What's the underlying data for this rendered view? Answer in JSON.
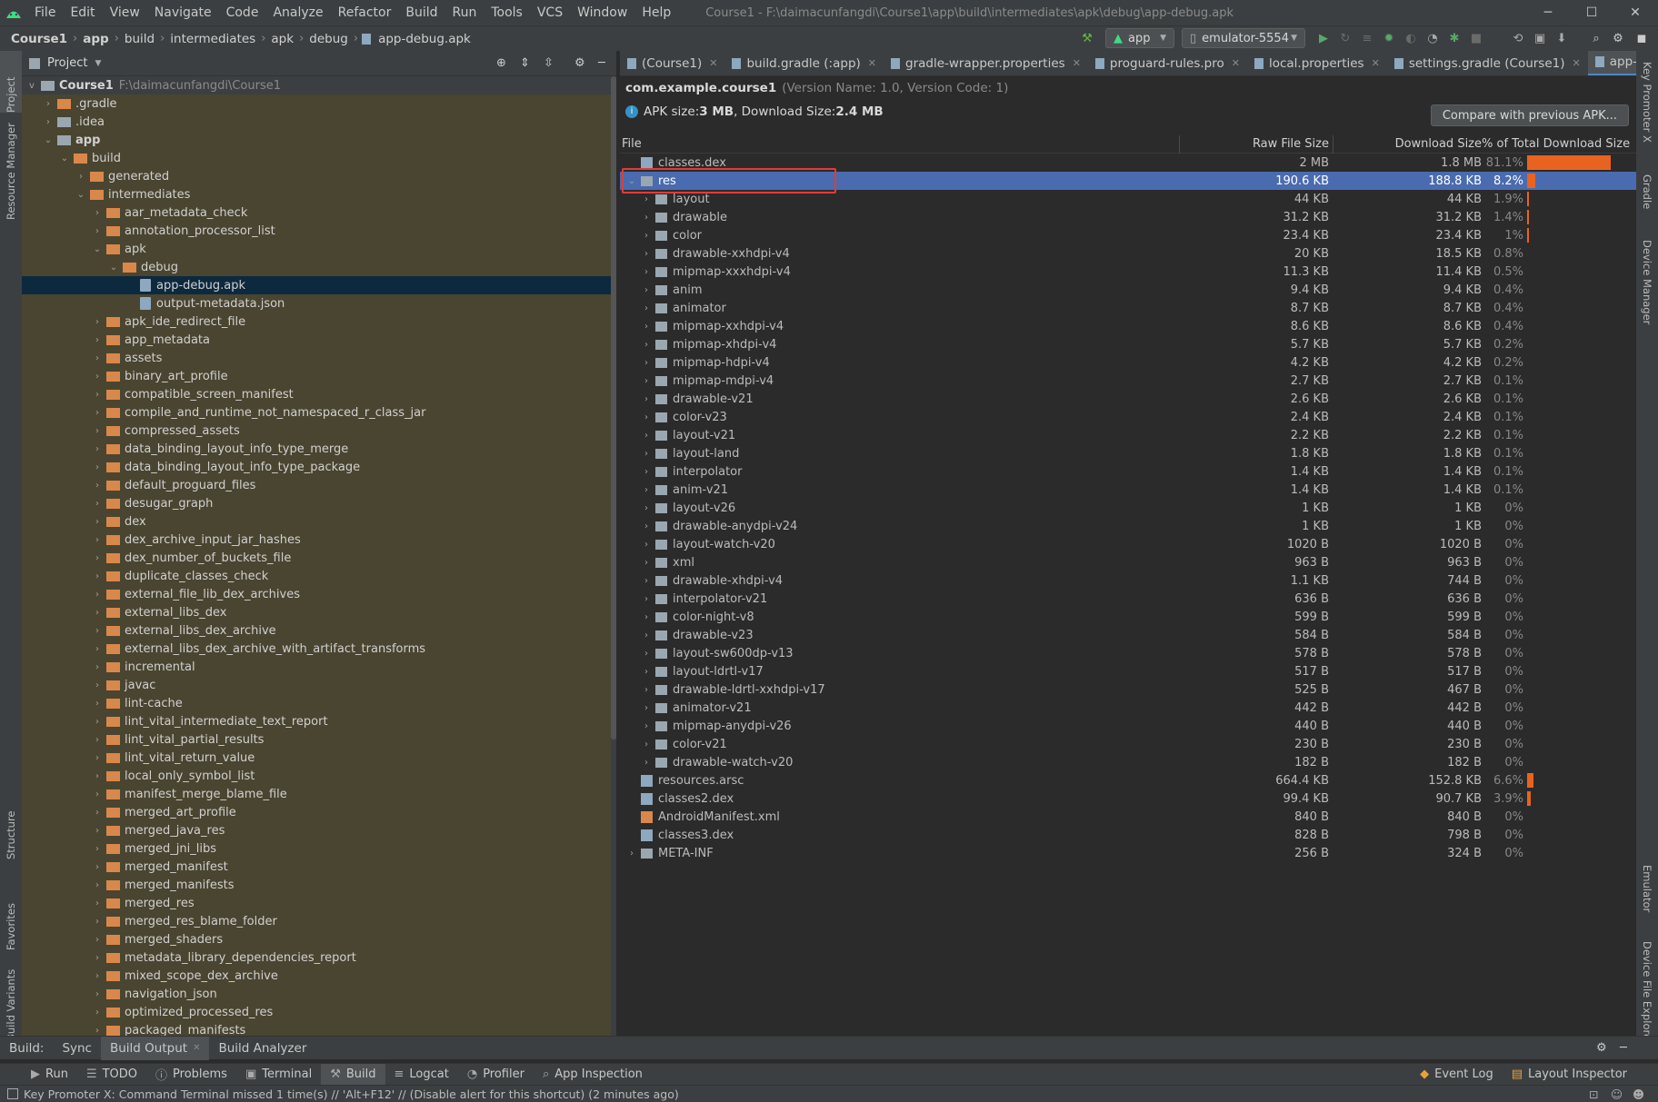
{
  "menubar": {
    "items": [
      "File",
      "Edit",
      "View",
      "Navigate",
      "Code",
      "Analyze",
      "Refactor",
      "Build",
      "Run",
      "Tools",
      "VCS",
      "Window",
      "Help"
    ],
    "window_title": "Course1 - F:\\daimacunfangdi\\Course1\\app\\build\\intermediates\\apk\\debug\\app-debug.apk"
  },
  "breadcrumb": [
    "Course1",
    "app",
    "build",
    "intermediates",
    "apk",
    "debug",
    "app-debug.apk"
  ],
  "toolbar": {
    "config": "app",
    "device": "emulator-5554"
  },
  "project_panel": {
    "title": "Project",
    "root_name": "Course1",
    "root_path": "F:\\daimacunfangdi\\Course1",
    "items": [
      {
        "label": ".gradle",
        "depth": 1,
        "arrow": ">",
        "kind": "orange",
        "hl": true
      },
      {
        "label": ".idea",
        "depth": 1,
        "arrow": ">",
        "kind": "grey",
        "hl": true
      },
      {
        "label": "app",
        "depth": 1,
        "arrow": "v",
        "kind": "grey",
        "hl": true,
        "bold": true
      },
      {
        "label": "build",
        "depth": 2,
        "arrow": "v",
        "kind": "orange",
        "hl": true
      },
      {
        "label": "generated",
        "depth": 3,
        "arrow": ">",
        "kind": "orange",
        "hl": true
      },
      {
        "label": "intermediates",
        "depth": 3,
        "arrow": "v",
        "kind": "orange",
        "hl": true
      },
      {
        "label": "aar_metadata_check",
        "depth": 4,
        "arrow": ">",
        "kind": "orange",
        "hl": true
      },
      {
        "label": "annotation_processor_list",
        "depth": 4,
        "arrow": ">",
        "kind": "orange",
        "hl": true
      },
      {
        "label": "apk",
        "depth": 4,
        "arrow": "v",
        "kind": "orange",
        "hl": true
      },
      {
        "label": "debug",
        "depth": 5,
        "arrow": "v",
        "kind": "orange",
        "hl": true
      },
      {
        "label": "app-debug.apk",
        "depth": 6,
        "arrow": "",
        "kind": "file",
        "sel": true
      },
      {
        "label": "output-metadata.json",
        "depth": 6,
        "arrow": "",
        "kind": "file",
        "hl": true
      },
      {
        "label": "apk_ide_redirect_file",
        "depth": 4,
        "arrow": ">",
        "kind": "orange",
        "hl": true
      },
      {
        "label": "app_metadata",
        "depth": 4,
        "arrow": ">",
        "kind": "orange",
        "hl": true
      },
      {
        "label": "assets",
        "depth": 4,
        "arrow": ">",
        "kind": "orange",
        "hl": true
      },
      {
        "label": "binary_art_profile",
        "depth": 4,
        "arrow": ">",
        "kind": "orange",
        "hl": true
      },
      {
        "label": "compatible_screen_manifest",
        "depth": 4,
        "arrow": ">",
        "kind": "orange",
        "hl": true
      },
      {
        "label": "compile_and_runtime_not_namespaced_r_class_jar",
        "depth": 4,
        "arrow": ">",
        "kind": "orange",
        "hl": true
      },
      {
        "label": "compressed_assets",
        "depth": 4,
        "arrow": ">",
        "kind": "orange",
        "hl": true
      },
      {
        "label": "data_binding_layout_info_type_merge",
        "depth": 4,
        "arrow": ">",
        "kind": "orange",
        "hl": true
      },
      {
        "label": "data_binding_layout_info_type_package",
        "depth": 4,
        "arrow": ">",
        "kind": "orange",
        "hl": true
      },
      {
        "label": "default_proguard_files",
        "depth": 4,
        "arrow": ">",
        "kind": "orange",
        "hl": true
      },
      {
        "label": "desugar_graph",
        "depth": 4,
        "arrow": ">",
        "kind": "orange",
        "hl": true
      },
      {
        "label": "dex",
        "depth": 4,
        "arrow": ">",
        "kind": "orange",
        "hl": true
      },
      {
        "label": "dex_archive_input_jar_hashes",
        "depth": 4,
        "arrow": ">",
        "kind": "orange",
        "hl": true
      },
      {
        "label": "dex_number_of_buckets_file",
        "depth": 4,
        "arrow": ">",
        "kind": "orange",
        "hl": true
      },
      {
        "label": "duplicate_classes_check",
        "depth": 4,
        "arrow": ">",
        "kind": "orange",
        "hl": true
      },
      {
        "label": "external_file_lib_dex_archives",
        "depth": 4,
        "arrow": ">",
        "kind": "orange",
        "hl": true
      },
      {
        "label": "external_libs_dex",
        "depth": 4,
        "arrow": ">",
        "kind": "orange",
        "hl": true
      },
      {
        "label": "external_libs_dex_archive",
        "depth": 4,
        "arrow": ">",
        "kind": "orange",
        "hl": true
      },
      {
        "label": "external_libs_dex_archive_with_artifact_transforms",
        "depth": 4,
        "arrow": ">",
        "kind": "orange",
        "hl": true
      },
      {
        "label": "incremental",
        "depth": 4,
        "arrow": ">",
        "kind": "orange",
        "hl": true
      },
      {
        "label": "javac",
        "depth": 4,
        "arrow": ">",
        "kind": "orange",
        "hl": true
      },
      {
        "label": "lint-cache",
        "depth": 4,
        "arrow": ">",
        "kind": "orange",
        "hl": true
      },
      {
        "label": "lint_vital_intermediate_text_report",
        "depth": 4,
        "arrow": ">",
        "kind": "orange",
        "hl": true
      },
      {
        "label": "lint_vital_partial_results",
        "depth": 4,
        "arrow": ">",
        "kind": "orange",
        "hl": true
      },
      {
        "label": "lint_vital_return_value",
        "depth": 4,
        "arrow": ">",
        "kind": "orange",
        "hl": true
      },
      {
        "label": "local_only_symbol_list",
        "depth": 4,
        "arrow": ">",
        "kind": "orange",
        "hl": true
      },
      {
        "label": "manifest_merge_blame_file",
        "depth": 4,
        "arrow": ">",
        "kind": "orange",
        "hl": true
      },
      {
        "label": "merged_art_profile",
        "depth": 4,
        "arrow": ">",
        "kind": "orange",
        "hl": true
      },
      {
        "label": "merged_java_res",
        "depth": 4,
        "arrow": ">",
        "kind": "orange",
        "hl": true
      },
      {
        "label": "merged_jni_libs",
        "depth": 4,
        "arrow": ">",
        "kind": "orange",
        "hl": true
      },
      {
        "label": "merged_manifest",
        "depth": 4,
        "arrow": ">",
        "kind": "orange",
        "hl": true
      },
      {
        "label": "merged_manifests",
        "depth": 4,
        "arrow": ">",
        "kind": "orange",
        "hl": true
      },
      {
        "label": "merged_res",
        "depth": 4,
        "arrow": ">",
        "kind": "orange",
        "hl": true
      },
      {
        "label": "merged_res_blame_folder",
        "depth": 4,
        "arrow": ">",
        "kind": "orange",
        "hl": true
      },
      {
        "label": "merged_shaders",
        "depth": 4,
        "arrow": ">",
        "kind": "orange",
        "hl": true
      },
      {
        "label": "metadata_library_dependencies_report",
        "depth": 4,
        "arrow": ">",
        "kind": "orange",
        "hl": true
      },
      {
        "label": "mixed_scope_dex_archive",
        "depth": 4,
        "arrow": ">",
        "kind": "orange",
        "hl": true
      },
      {
        "label": "navigation_json",
        "depth": 4,
        "arrow": ">",
        "kind": "orange",
        "hl": true
      },
      {
        "label": "optimized_processed_res",
        "depth": 4,
        "arrow": ">",
        "kind": "orange",
        "hl": true
      },
      {
        "label": "packaged_manifests",
        "depth": 4,
        "arrow": ">",
        "kind": "orange",
        "hl": true
      }
    ]
  },
  "editor_tabs": [
    {
      "label": "(Course1)",
      "active": false
    },
    {
      "label": "build.gradle (:app)",
      "active": false
    },
    {
      "label": "gradle-wrapper.properties",
      "active": false
    },
    {
      "label": "proguard-rules.pro",
      "active": false
    },
    {
      "label": "local.properties",
      "active": false
    },
    {
      "label": "settings.gradle (Course1)",
      "active": false
    },
    {
      "label": "app-debug.apk",
      "active": true
    }
  ],
  "apk": {
    "package": "com.example.course1",
    "version": "(Version Name: 1.0, Version Code: 1)",
    "size_label_a": "APK size: ",
    "size_a": "3 MB",
    "size_label_b": ", Download Size: ",
    "size_b": "2.4 MB",
    "compare_button": "Compare with previous APK..."
  },
  "table": {
    "headers": {
      "file": "File",
      "raw": "Raw File Size",
      "download": "Download Size",
      "pct": "% of Total Download Size"
    },
    "rows": [
      {
        "name": "classes.dex",
        "depth": 0,
        "arrow": "",
        "kind": "dex",
        "raw": "2 MB",
        "dl": "1.8 MB",
        "pct": "81.1%",
        "share": 81.1
      },
      {
        "name": "res",
        "depth": 0,
        "arrow": "v",
        "kind": "folder",
        "raw": "190.6 KB",
        "dl": "188.8 KB",
        "pct": "8.2%",
        "share": 8.2,
        "sel": true
      },
      {
        "name": "layout",
        "depth": 1,
        "arrow": ">",
        "kind": "folder",
        "raw": "44 KB",
        "dl": "44 KB",
        "pct": "1.9%",
        "share": 1.9
      },
      {
        "name": "drawable",
        "depth": 1,
        "arrow": ">",
        "kind": "folder",
        "raw": "31.2 KB",
        "dl": "31.2 KB",
        "pct": "1.4%",
        "share": 1.4
      },
      {
        "name": "color",
        "depth": 1,
        "arrow": ">",
        "kind": "folder",
        "raw": "23.4 KB",
        "dl": "23.4 KB",
        "pct": "1%",
        "share": 1.0
      },
      {
        "name": "drawable-xxhdpi-v4",
        "depth": 1,
        "arrow": ">",
        "kind": "folder",
        "raw": "20 KB",
        "dl": "18.5 KB",
        "pct": "0.8%",
        "share": 0
      },
      {
        "name": "mipmap-xxxhdpi-v4",
        "depth": 1,
        "arrow": ">",
        "kind": "folder",
        "raw": "11.3 KB",
        "dl": "11.4 KB",
        "pct": "0.5%",
        "share": 0
      },
      {
        "name": "anim",
        "depth": 1,
        "arrow": ">",
        "kind": "folder",
        "raw": "9.4 KB",
        "dl": "9.4 KB",
        "pct": "0.4%",
        "share": 0
      },
      {
        "name": "animator",
        "depth": 1,
        "arrow": ">",
        "kind": "folder",
        "raw": "8.7 KB",
        "dl": "8.7 KB",
        "pct": "0.4%",
        "share": 0
      },
      {
        "name": "mipmap-xxhdpi-v4",
        "depth": 1,
        "arrow": ">",
        "kind": "folder",
        "raw": "8.6 KB",
        "dl": "8.6 KB",
        "pct": "0.4%",
        "share": 0
      },
      {
        "name": "mipmap-xhdpi-v4",
        "depth": 1,
        "arrow": ">",
        "kind": "folder",
        "raw": "5.7 KB",
        "dl": "5.7 KB",
        "pct": "0.2%",
        "share": 0
      },
      {
        "name": "mipmap-hdpi-v4",
        "depth": 1,
        "arrow": ">",
        "kind": "folder",
        "raw": "4.2 KB",
        "dl": "4.2 KB",
        "pct": "0.2%",
        "share": 0
      },
      {
        "name": "mipmap-mdpi-v4",
        "depth": 1,
        "arrow": ">",
        "kind": "folder",
        "raw": "2.7 KB",
        "dl": "2.7 KB",
        "pct": "0.1%",
        "share": 0
      },
      {
        "name": "drawable-v21",
        "depth": 1,
        "arrow": ">",
        "kind": "folder",
        "raw": "2.6 KB",
        "dl": "2.6 KB",
        "pct": "0.1%",
        "share": 0
      },
      {
        "name": "color-v23",
        "depth": 1,
        "arrow": ">",
        "kind": "folder",
        "raw": "2.4 KB",
        "dl": "2.4 KB",
        "pct": "0.1%",
        "share": 0
      },
      {
        "name": "layout-v21",
        "depth": 1,
        "arrow": ">",
        "kind": "folder",
        "raw": "2.2 KB",
        "dl": "2.2 KB",
        "pct": "0.1%",
        "share": 0
      },
      {
        "name": "layout-land",
        "depth": 1,
        "arrow": ">",
        "kind": "folder",
        "raw": "1.8 KB",
        "dl": "1.8 KB",
        "pct": "0.1%",
        "share": 0
      },
      {
        "name": "interpolator",
        "depth": 1,
        "arrow": ">",
        "kind": "folder",
        "raw": "1.4 KB",
        "dl": "1.4 KB",
        "pct": "0.1%",
        "share": 0
      },
      {
        "name": "anim-v21",
        "depth": 1,
        "arrow": ">",
        "kind": "folder",
        "raw": "1.4 KB",
        "dl": "1.4 KB",
        "pct": "0.1%",
        "share": 0
      },
      {
        "name": "layout-v26",
        "depth": 1,
        "arrow": ">",
        "kind": "folder",
        "raw": "1 KB",
        "dl": "1 KB",
        "pct": "0%",
        "share": 0
      },
      {
        "name": "drawable-anydpi-v24",
        "depth": 1,
        "arrow": ">",
        "kind": "folder",
        "raw": "1 KB",
        "dl": "1 KB",
        "pct": "0%",
        "share": 0
      },
      {
        "name": "layout-watch-v20",
        "depth": 1,
        "arrow": ">",
        "kind": "folder",
        "raw": "1020 B",
        "dl": "1020 B",
        "pct": "0%",
        "share": 0
      },
      {
        "name": "xml",
        "depth": 1,
        "arrow": ">",
        "kind": "folder",
        "raw": "963 B",
        "dl": "963 B",
        "pct": "0%",
        "share": 0
      },
      {
        "name": "drawable-xhdpi-v4",
        "depth": 1,
        "arrow": ">",
        "kind": "folder",
        "raw": "1.1 KB",
        "dl": "744 B",
        "pct": "0%",
        "share": 0
      },
      {
        "name": "interpolator-v21",
        "depth": 1,
        "arrow": ">",
        "kind": "folder",
        "raw": "636 B",
        "dl": "636 B",
        "pct": "0%",
        "share": 0
      },
      {
        "name": "color-night-v8",
        "depth": 1,
        "arrow": ">",
        "kind": "folder",
        "raw": "599 B",
        "dl": "599 B",
        "pct": "0%",
        "share": 0
      },
      {
        "name": "drawable-v23",
        "depth": 1,
        "arrow": ">",
        "kind": "folder",
        "raw": "584 B",
        "dl": "584 B",
        "pct": "0%",
        "share": 0
      },
      {
        "name": "layout-sw600dp-v13",
        "depth": 1,
        "arrow": ">",
        "kind": "folder",
        "raw": "578 B",
        "dl": "578 B",
        "pct": "0%",
        "share": 0
      },
      {
        "name": "layout-ldrtl-v17",
        "depth": 1,
        "arrow": ">",
        "kind": "folder",
        "raw": "517 B",
        "dl": "517 B",
        "pct": "0%",
        "share": 0
      },
      {
        "name": "drawable-ldrtl-xxhdpi-v17",
        "depth": 1,
        "arrow": ">",
        "kind": "folder",
        "raw": "525 B",
        "dl": "467 B",
        "pct": "0%",
        "share": 0
      },
      {
        "name": "animator-v21",
        "depth": 1,
        "arrow": ">",
        "kind": "folder",
        "raw": "442 B",
        "dl": "442 B",
        "pct": "0%",
        "share": 0
      },
      {
        "name": "mipmap-anydpi-v26",
        "depth": 1,
        "arrow": ">",
        "kind": "folder",
        "raw": "440 B",
        "dl": "440 B",
        "pct": "0%",
        "share": 0
      },
      {
        "name": "color-v21",
        "depth": 1,
        "arrow": ">",
        "kind": "folder",
        "raw": "230 B",
        "dl": "230 B",
        "pct": "0%",
        "share": 0
      },
      {
        "name": "drawable-watch-v20",
        "depth": 1,
        "arrow": ">",
        "kind": "folder",
        "raw": "182 B",
        "dl": "182 B",
        "pct": "0%",
        "share": 0
      },
      {
        "name": "resources.arsc",
        "depth": 0,
        "arrow": "",
        "kind": "dex",
        "raw": "664.4 KB",
        "dl": "152.8 KB",
        "pct": "6.6%",
        "share": 6.6
      },
      {
        "name": "classes2.dex",
        "depth": 0,
        "arrow": "",
        "kind": "dex",
        "raw": "99.4 KB",
        "dl": "90.7 KB",
        "pct": "3.9%",
        "share": 3.9
      },
      {
        "name": "AndroidManifest.xml",
        "depth": 0,
        "arrow": "",
        "kind": "xml",
        "raw": "840 B",
        "dl": "840 B",
        "pct": "0%",
        "share": 0
      },
      {
        "name": "classes3.dex",
        "depth": 0,
        "arrow": "",
        "kind": "dex",
        "raw": "828 B",
        "dl": "798 B",
        "pct": "0%",
        "share": 0
      },
      {
        "name": "META-INF",
        "depth": 0,
        "arrow": ">",
        "kind": "folder",
        "raw": "256 B",
        "dl": "324 B",
        "pct": "0%",
        "share": 0
      }
    ]
  },
  "left_strip": [
    "Project",
    "Resource Manager",
    "Structure",
    "Favorites",
    "Build Variants"
  ],
  "right_strip": [
    "Key Promoter X",
    "Gradle",
    "Device Manager",
    "Emulator",
    "Device File Explorer"
  ],
  "build_tabs": {
    "label": "Build:",
    "sync": "Sync",
    "output": "Build Output",
    "analyzer": "Build Analyzer"
  },
  "tool_windows": [
    "Run",
    "TODO",
    "Problems",
    "Terminal",
    "Build",
    "Logcat",
    "Profiler",
    "App Inspection"
  ],
  "tool_windows_right": [
    "Event Log",
    "Layout Inspector"
  ],
  "status": "Key Promoter X: Command Terminal missed 1 time(s) // 'Alt+F12' // (Disable alert for this shortcut) (2 minutes ago)",
  "colors": {
    "accent": "#4a88c7",
    "selection": "#4a6baf",
    "bar": "#e96320",
    "folder": "#d9884b",
    "highlight": "#e23b3b"
  }
}
